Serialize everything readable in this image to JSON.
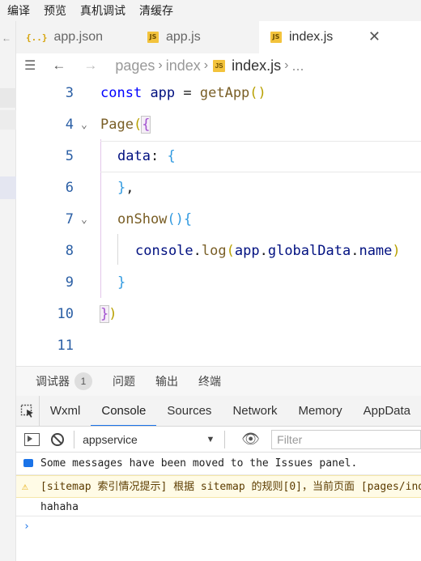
{
  "toolbar": {
    "items": [
      "编译",
      "预览",
      "真机调试",
      "清缓存"
    ]
  },
  "tabs": [
    {
      "icon": "{..}",
      "label": "app.json"
    },
    {
      "icon": "JS",
      "label": "app.js"
    },
    {
      "icon": "JS",
      "label": "index.js",
      "close": "✕"
    }
  ],
  "breadcrumb": {
    "segments": [
      "pages",
      "index",
      "index.js",
      "..."
    ],
    "js_icon": "JS"
  },
  "editor": {
    "line_numbers": [
      "3",
      "4",
      "5",
      "6",
      "7",
      "8",
      "9",
      "10",
      "11"
    ]
  },
  "panel": {
    "tabs": [
      "调试器",
      "问题",
      "输出",
      "终端"
    ],
    "badge": "1",
    "devtools_tabs": [
      "Wxml",
      "Console",
      "Sources",
      "Network",
      "Memory",
      "AppData"
    ],
    "context": "appservice",
    "filter_placeholder": "Filter",
    "messages": [
      "Some messages have been moved to the Issues panel.",
      "[sitemap 索引情况提示] 根据 sitemap 的规则[0]，当前页面 [pages/index/index] 将被索引",
      "hahaha"
    ],
    "prompt": "›"
  }
}
